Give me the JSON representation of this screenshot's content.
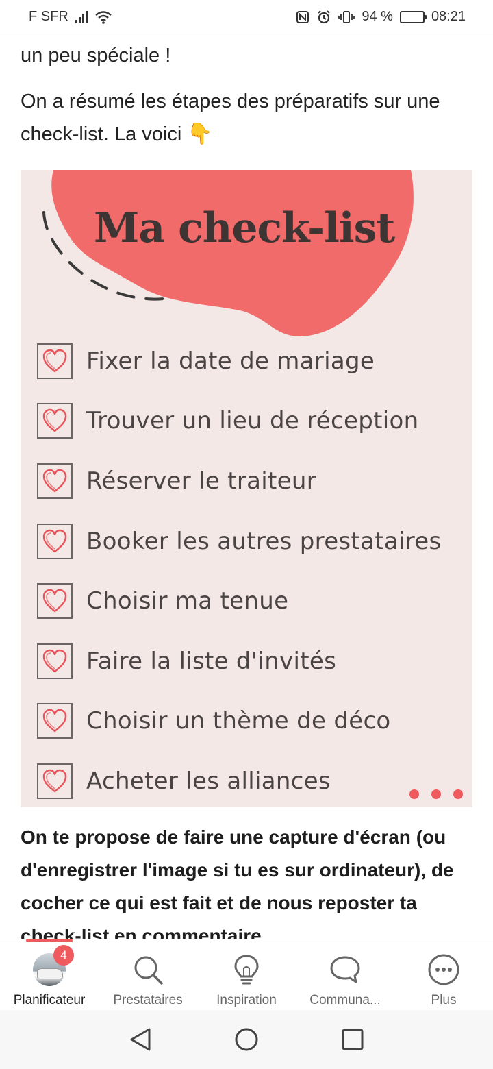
{
  "status_bar": {
    "carrier": "F SFR",
    "battery_percent": "94 %",
    "battery_level": 0.94,
    "time": "08:21"
  },
  "article": {
    "top_fragment": "un peu spéciale !",
    "intro_text": "On a résumé les étapes des préparatifs sur une check-list. La voici",
    "intro_emoji": "👇",
    "checklist_image": {
      "title": "Ma check-list",
      "items": [
        "Fixer la date de mariage",
        "Trouver un lieu de réception",
        "Réserver le traiteur",
        "Booker les autres prestataires",
        "Choisir ma tenue",
        "Faire la liste d'invités",
        "Choisir un thème de déco",
        "Acheter les alliances"
      ],
      "carousel_pages": 3
    },
    "bold_text": "On te propose de faire une capture d'écran (ou d'enregistrer l'image si tu es sur ordinateur), de cocher ce qui est fait et de nous reposter ta check-list en commentaire"
  },
  "bottom_nav": {
    "items": [
      {
        "label": "Planificateur",
        "icon": "avatar",
        "badge": "4",
        "active": true
      },
      {
        "label": "Prestataires",
        "icon": "search-icon"
      },
      {
        "label": "Inspiration",
        "icon": "lightbulb-icon"
      },
      {
        "label": "Communa...",
        "icon": "chat-bubble-icon"
      },
      {
        "label": "Plus",
        "icon": "more-dots-icon"
      }
    ]
  },
  "colors": {
    "accent": "#ef5a5f",
    "blob": "#f26b6b",
    "image_bg": "#f4e8e6",
    "heart": "#e8545a"
  }
}
